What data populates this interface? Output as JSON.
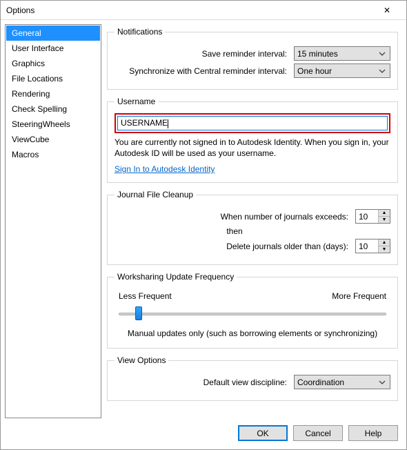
{
  "window": {
    "title": "Options"
  },
  "sidebar": {
    "items": [
      {
        "label": "General",
        "selected": true
      },
      {
        "label": "User Interface"
      },
      {
        "label": "Graphics"
      },
      {
        "label": "File Locations"
      },
      {
        "label": "Rendering"
      },
      {
        "label": "Check Spelling"
      },
      {
        "label": "SteeringWheels"
      },
      {
        "label": "ViewCube"
      },
      {
        "label": "Macros"
      }
    ]
  },
  "notifications": {
    "legend": "Notifications",
    "save_label": "Save reminder interval:",
    "save_value": "15 minutes",
    "sync_label": "Synchronize with Central reminder interval:",
    "sync_value": "One hour"
  },
  "username": {
    "legend": "Username",
    "value": "USERNAME",
    "note": "You are currently not signed in to Autodesk Identity. When you sign in, your Autodesk ID will be used as your username.",
    "link": "Sign In to Autodesk Identity"
  },
  "journal": {
    "legend": "Journal File Cleanup",
    "exceeds_label": "When number of journals exceeds:",
    "exceeds_value": "10",
    "then_label": "then",
    "older_label": "Delete journals older than (days):",
    "older_value": "10"
  },
  "worksharing": {
    "legend": "Worksharing Update Frequency",
    "less": "Less Frequent",
    "more": "More Frequent",
    "note": "Manual updates only (such as borrowing elements or synchronizing)"
  },
  "viewopts": {
    "legend": "View Options",
    "discipline_label": "Default view discipline:",
    "discipline_value": "Coordination"
  },
  "buttons": {
    "ok": "OK",
    "cancel": "Cancel",
    "help": "Help"
  }
}
